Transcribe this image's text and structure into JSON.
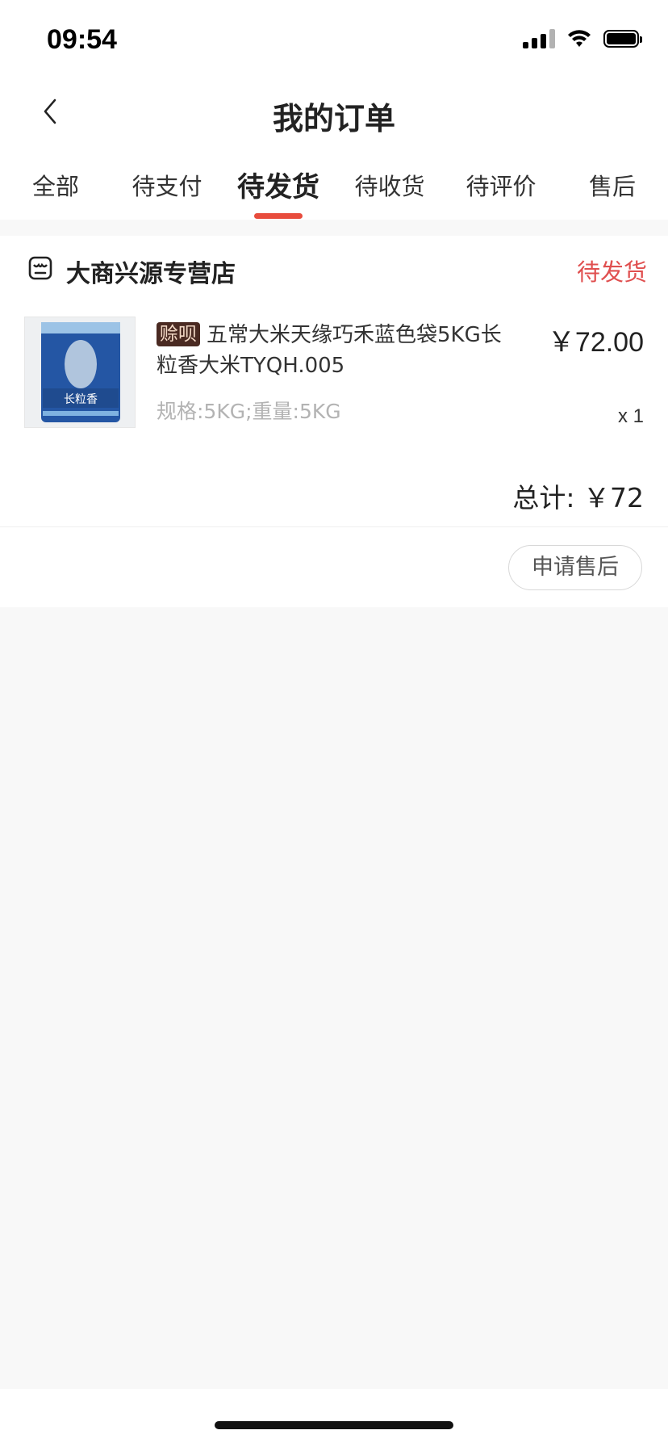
{
  "status_bar": {
    "time": "09:54"
  },
  "nav": {
    "title": "我的订单",
    "back_icon": "chevron-left-icon"
  },
  "tabs": [
    {
      "label": "全部",
      "active": false
    },
    {
      "label": "待支付",
      "active": false
    },
    {
      "label": "待发货",
      "active": true
    },
    {
      "label": "待收货",
      "active": false
    },
    {
      "label": "待评价",
      "active": false
    },
    {
      "label": "售后",
      "active": false
    }
  ],
  "order": {
    "shop_name": "大商兴源专营店",
    "shop_icon": "store-icon",
    "status": "待发货",
    "product": {
      "tag": "赊呗",
      "title": "五常大米天缘巧禾蓝色袋5KG长粒香大米TYQH.005",
      "price": "￥72.00",
      "spec": "规格:5KG;重量:5KG",
      "quantity": "x 1",
      "package_text": "长粒香"
    },
    "total": "总计: ￥72",
    "aftersale_button": "申请售后"
  },
  "colors": {
    "accent": "#e84c3d",
    "status_red": "#e04f4f",
    "tag_bg": "#4a2a22"
  }
}
